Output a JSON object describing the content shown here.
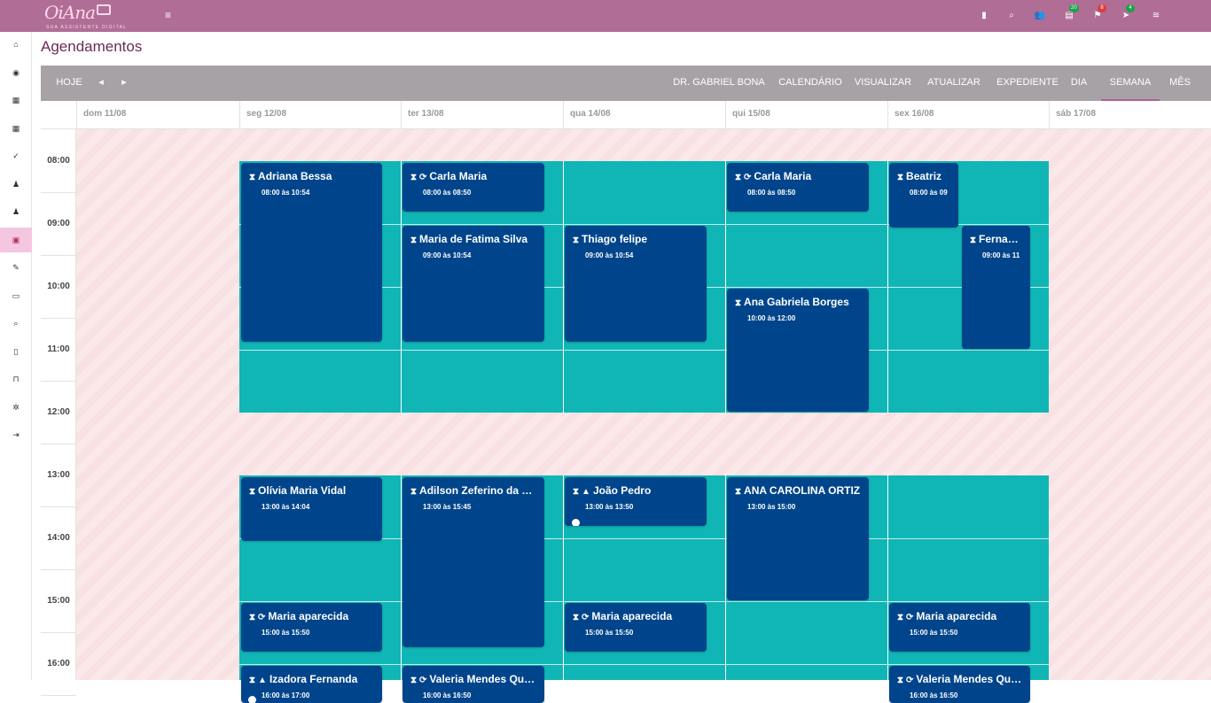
{
  "brand": {
    "name": "OiAna",
    "tagline": "SUA ASSISTENTE DIGITAL"
  },
  "topbar": {
    "icons": [
      {
        "icon": "calculator-icon",
        "glyph": "▮",
        "badge": ""
      },
      {
        "icon": "search-icon",
        "glyph": "⌕",
        "badge": ""
      },
      {
        "icon": "users-icon",
        "glyph": "👥",
        "badge": ""
      },
      {
        "icon": "clipboard-icon",
        "glyph": "▤",
        "badge": "20",
        "badge_color": "#1aa34a"
      },
      {
        "icon": "flag-icon",
        "glyph": "⚑",
        "badge": "8",
        "badge_color": "#e03b3b"
      },
      {
        "icon": "rocket-icon",
        "glyph": "➤",
        "badge": "4",
        "badge_color": "#1aa34a"
      },
      {
        "icon": "wifi-icon",
        "glyph": "≋",
        "badge": ""
      }
    ]
  },
  "sidebar": {
    "items": [
      {
        "icon": "home-icon",
        "glyph": "⌂"
      },
      {
        "icon": "globe-icon",
        "glyph": "◉"
      },
      {
        "icon": "calendar-icon",
        "glyph": "▦"
      },
      {
        "icon": "calendar-plus-icon",
        "glyph": "▦"
      },
      {
        "icon": "check-icon",
        "glyph": "✓"
      },
      {
        "icon": "users-icon",
        "glyph": "♟"
      },
      {
        "icon": "user-plus-icon",
        "glyph": "♟"
      },
      {
        "icon": "money-icon",
        "glyph": "▣",
        "active": true
      },
      {
        "icon": "edit-icon",
        "glyph": "✎"
      },
      {
        "icon": "wallet-icon",
        "glyph": "▭"
      },
      {
        "icon": "search-icon",
        "glyph": "⌕"
      },
      {
        "icon": "file-icon",
        "glyph": "▯"
      },
      {
        "icon": "cart-icon",
        "glyph": "⊓"
      },
      {
        "icon": "gear-icon",
        "glyph": "✲"
      },
      {
        "icon": "logout-icon",
        "glyph": "⇥"
      }
    ]
  },
  "page": {
    "title": "Agendamentos"
  },
  "toolbar": {
    "today": "HOJE",
    "prev_glyph": "◂",
    "next_glyph": "▸",
    "doctor": "DR. GABRIEL BONA",
    "calendar": "CALENDÁRIO",
    "view": "VISUALIZAR",
    "refresh": "ATUALIZAR",
    "schedule": "EXPEDIENTE",
    "day": "DIA",
    "week": "SEMANA",
    "month": "MÊS",
    "active": "week"
  },
  "calendar": {
    "days": [
      "dom 11/08",
      "seg 12/08",
      "ter 13/08",
      "qua 14/08",
      "qui 15/08",
      "sex 16/08",
      "sáb 17/08"
    ],
    "hours": [
      "08:00",
      "09:00",
      "10:00",
      "11:00",
      "12:00",
      "13:00",
      "14:00",
      "15:00",
      "16:00"
    ],
    "working_days": [
      1,
      2,
      3,
      4,
      5
    ],
    "working_blocks": [
      [
        8,
        12
      ],
      [
        13,
        17
      ]
    ],
    "events": [
      {
        "day": 1,
        "start": 8,
        "end": 10.9,
        "title": "Adriana Bessa",
        "time": "08:00 às 10:54",
        "recurring": false,
        "warning": false
      },
      {
        "day": 2,
        "start": 8,
        "end": 8.83,
        "title": "Carla Maria",
        "time": "08:00 às 08:50",
        "recurring": true,
        "warning": false
      },
      {
        "day": 2,
        "start": 9,
        "end": 10.9,
        "title": "Maria de Fatima Silva",
        "time": "09:00 às 10:54",
        "recurring": false,
        "warning": false
      },
      {
        "day": 3,
        "start": 9,
        "end": 10.9,
        "title": "Thiago felipe",
        "time": "09:00 às 10:54",
        "recurring": false,
        "warning": false
      },
      {
        "day": 4,
        "start": 8,
        "end": 8.83,
        "title": "Carla Maria",
        "time": "08:00 às 08:50",
        "recurring": true,
        "warning": false
      },
      {
        "day": 4,
        "start": 10,
        "end": 12,
        "title": "Ana Gabriela Borges",
        "time": "10:00 às 12:00",
        "recurring": false,
        "warning": false
      },
      {
        "day": 5,
        "start": 8,
        "end": 9.08,
        "title": "Beatriz",
        "time": "08:00 às 09",
        "recurring": false,
        "warning": false,
        "half": "left"
      },
      {
        "day": 5,
        "start": 9,
        "end": 11,
        "title": "Fernanda",
        "time": "09:00 às 11",
        "recurring": false,
        "warning": false,
        "half": "right"
      },
      {
        "day": 1,
        "start": 13,
        "end": 14.07,
        "title": "Olívia Maria Vidal",
        "time": "13:00 às 14:04",
        "recurring": false,
        "warning": false
      },
      {
        "day": 2,
        "start": 13,
        "end": 15.75,
        "title": "Adilson Zeferino da Silva",
        "time": "13:00 às 15:45",
        "recurring": false,
        "warning": false
      },
      {
        "day": 3,
        "start": 13,
        "end": 13.83,
        "title": "João Pedro",
        "time": "13:00 às 13:50",
        "recurring": false,
        "warning": true,
        "dot": true
      },
      {
        "day": 4,
        "start": 13,
        "end": 15,
        "title": "ANA CAROLINA ORTIZ",
        "time": "13:00 às 15:00",
        "recurring": false,
        "warning": false
      },
      {
        "day": 1,
        "start": 15,
        "end": 15.83,
        "title": "Maria aparecida",
        "time": "15:00 às 15:50",
        "recurring": true,
        "warning": false
      },
      {
        "day": 3,
        "start": 15,
        "end": 15.83,
        "title": "Maria aparecida",
        "time": "15:00 às 15:50",
        "recurring": true,
        "warning": false
      },
      {
        "day": 5,
        "start": 15,
        "end": 15.83,
        "title": "Maria aparecida",
        "time": "15:00 às 15:50",
        "recurring": true,
        "warning": false
      },
      {
        "day": 1,
        "start": 16,
        "end": 17,
        "title": "Izadora Fernanda",
        "time": "16:00 às 17:00",
        "recurring": false,
        "warning": true,
        "dot": true
      },
      {
        "day": 2,
        "start": 16,
        "end": 16.83,
        "title": "Valeria Mendes Queiroz",
        "time": "16:00 às 16:50",
        "recurring": true,
        "warning": false
      },
      {
        "day": 5,
        "start": 16,
        "end": 16.83,
        "title": "Valeria Mendes Queiroz",
        "time": "16:00 às 16:50",
        "recurring": true,
        "warning": false
      }
    ]
  },
  "colors": {
    "event": "#00458b",
    "working": "#10b6b5",
    "topbar": "#b06d96",
    "toolbar": "#a7a2a6"
  }
}
